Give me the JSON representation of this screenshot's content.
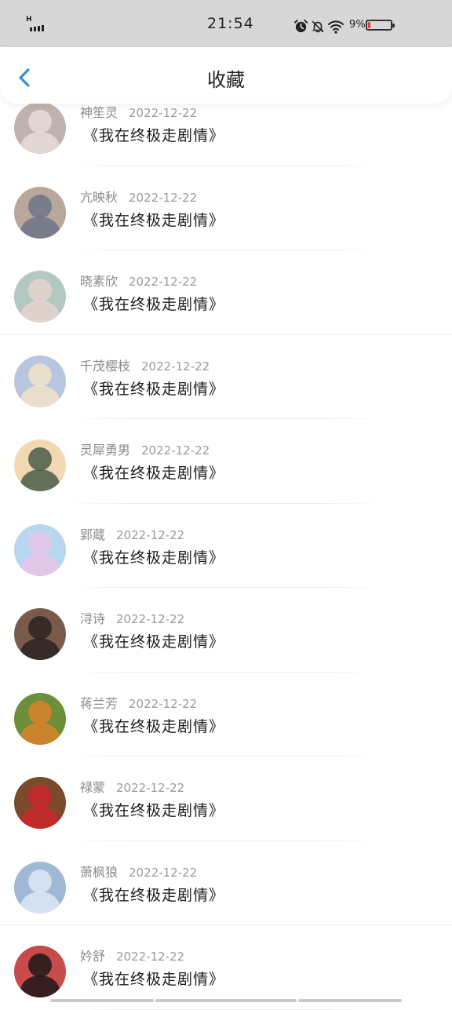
{
  "status_bar": {
    "network_label": "H",
    "time": "21:54",
    "battery_percent_text": "9%",
    "battery_level": 0.09,
    "icons": [
      "alarm-icon",
      "mute-icon",
      "wifi-icon",
      "battery-icon"
    ]
  },
  "header": {
    "back_icon": "chevron-left-icon",
    "title": "收藏"
  },
  "colors": {
    "accent": "#2f8fe0",
    "status_bar_bg": "#d7d7d7",
    "battery_low": "#e53935"
  },
  "favorites": [
    {
      "name": "神笙灵",
      "date": "2022-12-22",
      "title": "《我在终极走剧情》",
      "avatar_colors": [
        "#e8dcd8",
        "#bfb3ad"
      ]
    },
    {
      "name": "亢映秋",
      "date": "2022-12-22",
      "title": "《我在终极走剧情》",
      "avatar_colors": [
        "#6d7488",
        "#b8a79a"
      ]
    },
    {
      "name": "晓素欣",
      "date": "2022-12-22",
      "title": "《我在终极走剧情》",
      "avatar_colors": [
        "#e6d3cf",
        "#b4c8c2"
      ]
    },
    {
      "name": "千茂樱枝",
      "date": "2022-12-22",
      "title": "《我在终极走剧情》",
      "avatar_colors": [
        "#f1e3c8",
        "#b9c6e0"
      ]
    },
    {
      "name": "灵犀勇男",
      "date": "2022-12-22",
      "title": "《我在终极走剧情》",
      "avatar_colors": [
        "#4a5a4a",
        "#f3d9b1"
      ]
    },
    {
      "name": "郢蔵",
      "date": "2022-12-22",
      "title": "《我在终极走剧情》",
      "avatar_colors": [
        "#e9c6e6",
        "#b7d6f0"
      ]
    },
    {
      "name": "浔诗",
      "date": "2022-12-22",
      "title": "《我在终极走剧情》",
      "avatar_colors": [
        "#2b2323",
        "#7a5a4c"
      ]
    },
    {
      "name": "蒋兰芳",
      "date": "2022-12-22",
      "title": "《我在终极走剧情》",
      "avatar_colors": [
        "#d9822b",
        "#6d8f3a"
      ]
    },
    {
      "name": "禄蒙",
      "date": "2022-12-22",
      "title": "《我在终极走剧情》",
      "avatar_colors": [
        "#c9262c",
        "#7a4a2a"
      ]
    },
    {
      "name": "萧枫狼",
      "date": "2022-12-22",
      "title": "《我在终极走剧情》",
      "avatar_colors": [
        "#dfe8f3",
        "#9fb8d6"
      ]
    },
    {
      "name": "妗舒",
      "date": "2022-12-22",
      "title": "《我在终极走剧情》",
      "avatar_colors": [
        "#1d1617",
        "#c94a4a"
      ]
    }
  ]
}
